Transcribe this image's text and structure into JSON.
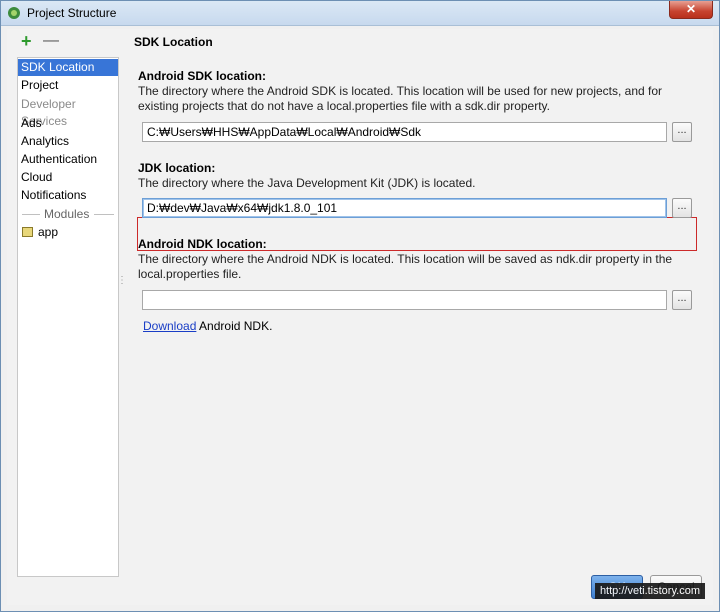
{
  "window": {
    "title": "Project Structure",
    "close_glyph": "✕"
  },
  "toolbar": {
    "add_glyph": "+",
    "remove_glyph": "—"
  },
  "sidebar": {
    "items": [
      {
        "label": "SDK Location",
        "selected": true
      },
      {
        "label": "Project"
      },
      {
        "label": "Developer Services",
        "group": true
      },
      {
        "label": "Ads"
      },
      {
        "label": "Analytics"
      },
      {
        "label": "Authentication"
      },
      {
        "label": "Cloud"
      },
      {
        "label": "Notifications"
      }
    ],
    "modules_header": "Modules",
    "modules": [
      {
        "label": "app",
        "icon": "module-folder-icon"
      }
    ]
  },
  "main": {
    "section_title": "SDK Location",
    "android_sdk": {
      "label": "Android SDK location:",
      "description": "The directory where the Android SDK is located. This location will be used for new projects, and for existing projects that do not have a local.properties file with a sdk.dir property.",
      "value": "C:₩Users₩HHS₩AppData₩Local₩Android₩Sdk",
      "browse": "..."
    },
    "jdk": {
      "label": "JDK location:",
      "description": "The directory where the Java Development Kit (JDK) is located.",
      "value": "D:₩dev₩Java₩x64₩jdk1.8.0_101",
      "browse": "..."
    },
    "ndk": {
      "label": "Android NDK location:",
      "description": "The directory where the Android NDK is located. This location will be saved as ndk.dir property in the local.properties file.",
      "value": "",
      "browse": "...",
      "download_link": "Download",
      "download_suffix": " Android NDK."
    }
  },
  "buttons": {
    "ok": "OK",
    "cancel": "Cancel"
  },
  "watermark": "http://veti.tistory.com",
  "colors": {
    "selection": "#3875d7",
    "highlight_border": "#cc2a2a",
    "link": "#1a3ec6"
  }
}
